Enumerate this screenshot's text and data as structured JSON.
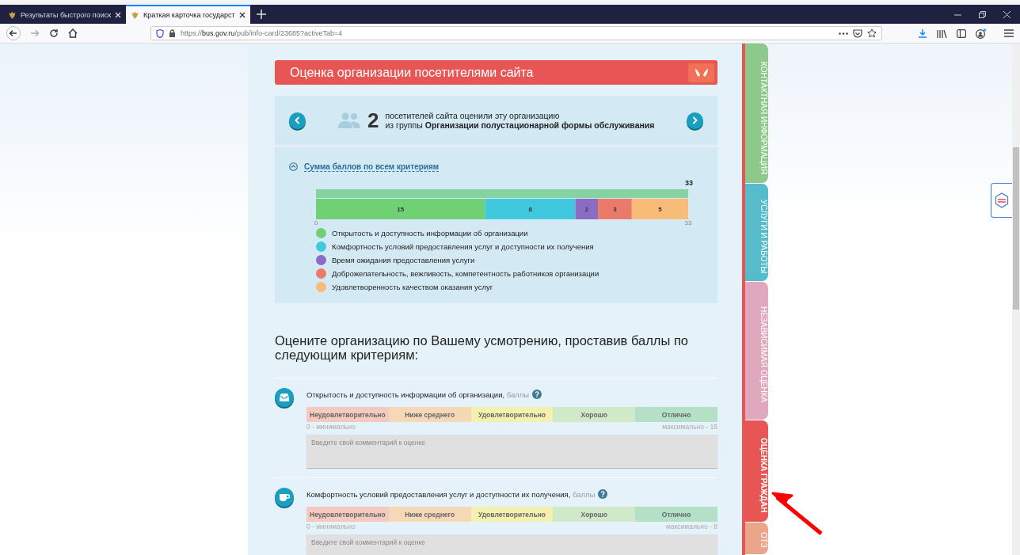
{
  "browser": {
    "tabs": [
      {
        "title": "Результаты быстрого поиск",
        "selected": false
      },
      {
        "title": "Краткая карточка государст",
        "selected": true
      }
    ],
    "url": {
      "scheme": "https://",
      "host": "bus.gov.ru",
      "path": "/pub/info-card/23685?activeTab=4"
    }
  },
  "rating": {
    "title": "Оценка организации посетителями сайта",
    "count": "2",
    "count_text": "посетителей сайта оценили эту организацию",
    "group_prefix": "из группы",
    "group_name": "Организации полустационарной формы обслуживания",
    "summary_toggle": {
      "label": "Сумма баллов по всем критериям",
      "expanded": true
    },
    "total": {
      "label": "33",
      "level": 1
    },
    "chart_data": {
      "type": "bar",
      "orientation": "horizontal",
      "stacked": true,
      "xlim": [
        0,
        33
      ],
      "xticks": [
        0,
        33
      ],
      "data_labels": true,
      "series": [
        {
          "name": "Открытость и доступность информации об организации",
          "color": "#6fd074",
          "values": [
            15
          ]
        },
        {
          "name": "Комфортность условий предоставления услуг и доступности их получения",
          "color": "#40c8de",
          "values": [
            8
          ]
        },
        {
          "name": "Время ожидания предоставления услуги",
          "color": "#8a6cc4",
          "values": [
            2
          ]
        },
        {
          "name": "Доброжелательность, вежливость, компетентность работников организации",
          "color": "#ec7a6a",
          "values": [
            3
          ]
        },
        {
          "name": "Удовлетворенность качеством оказания услуг",
          "color": "#f8bb78",
          "values": [
            5
          ]
        }
      ]
    }
  },
  "form": {
    "heading": "Оцените организацию по Вашему усмотрению, проставив баллы по следующим критериям:",
    "criteria": [
      {
        "kind": "inbox",
        "title": "Открытость и доступность информации об организации,",
        "unit": "баллы",
        "scale": [
          "Неудовлетворительно",
          "Ниже среднего",
          "Удовлетворительно",
          "Хорошо",
          "Отлично"
        ],
        "min": "0 - минимально",
        "max": "максимально - 15",
        "placeholder": "Введите свой комментарий к оценке"
      },
      {
        "kind": "cup",
        "title": "Комфортность условий предоставления услуг и доступности их получения,",
        "unit": "баллы",
        "scale": [
          "Неудовлетворительно",
          "Ниже среднего",
          "Удовлетворительно",
          "Хорошо",
          "Отлично"
        ],
        "min": "0 - минимально",
        "max": "максимально - 8",
        "placeholder": "Введите свой комментарий к оценке"
      }
    ]
  },
  "side_tabs": [
    {
      "label": "КОНТАКТНАЯ ИНФОРМАЦИЯ",
      "color": "#8cc98a",
      "selected": false
    },
    {
      "label": "УСЛУГИ И РАБОТЫ",
      "color": "#56bccc",
      "selected": false
    },
    {
      "label": "НЕЗАВИСИМАЯ ОЦЕНКА",
      "color": "#e0a8bd",
      "selected": false
    },
    {
      "label": "ОЦЕНКА ГРАЖДАН",
      "color": "#e85555",
      "selected": true
    },
    {
      "label": "ОТЗ",
      "color": "#eaa58a",
      "selected": false
    }
  ]
}
